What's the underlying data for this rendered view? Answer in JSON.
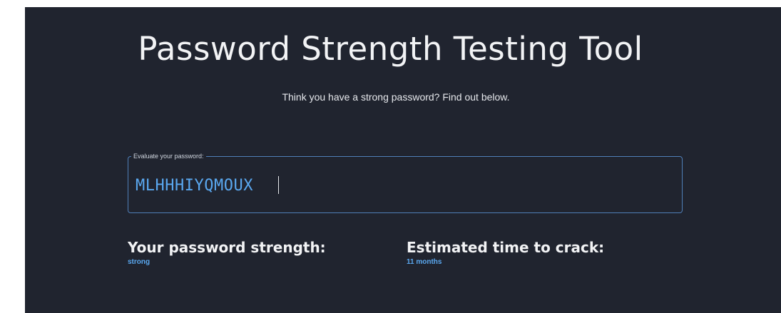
{
  "header": {
    "title": "Password Strength Testing Tool",
    "subtitle": "Think you have a strong password? Find out below."
  },
  "password_field": {
    "legend": "Evaluate your password:",
    "value": "MLHHHIYQMOUX"
  },
  "results": {
    "strength_label": "Your password strength:",
    "strength_value": "strong",
    "crack_time_label": "Estimated time to crack:",
    "crack_time_value": "11 months"
  },
  "colors": {
    "background": "#20242f",
    "accent": "#5aa8f0",
    "border": "#4f7fb8",
    "text": "#f2f3f5"
  }
}
